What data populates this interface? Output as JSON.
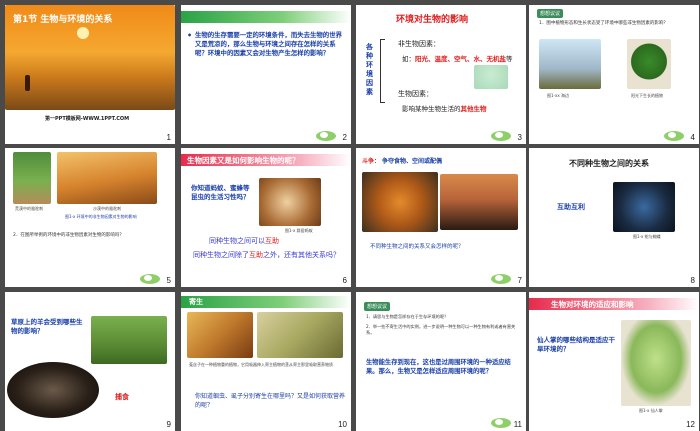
{
  "slides": [
    {
      "num": "1",
      "title": "第1节 生物与环境的关系",
      "footer": "第一PPT模板网-WWW.1PPT.COM"
    },
    {
      "num": "2",
      "bullet": "•",
      "text": "生物的生存需要一定的环境条件，而失去生物的世界又是荒凉的，那么生物与环境之间存在怎样的关系呢？环境中的因素又会对生物产生怎样的影响？"
    },
    {
      "num": "3",
      "title": "环境对生物的影响",
      "side": "各种环境因素",
      "abiotic": "非生物因素：",
      "abiotic_eg_prefix": "如：",
      "abiotic_eg": "阳光、温度、空气、水、无机盐",
      "abiotic_eg_suffix": "等",
      "biotic": "生物因素：",
      "biotic_desc_prefix": "影响某种生物生活的",
      "biotic_desc": "其他生物"
    },
    {
      "num": "4",
      "tag": "想想议议",
      "q": "1．图中植物形态和生长状态受了环境中哪些非生物因素的影响？",
      "cap1": "图1-xx 海边",
      "cap2": "阳光下生长的植物"
    },
    {
      "num": "5",
      "cap1": "荒漠中的骆驼刺",
      "cap2": "沙漠中的骆驼刺",
      "capline": "图1-x 环境中的非生物因素对生物的影响",
      "q": "2．在图所举例的环境中的非生物因素对生物的影响吗？"
    },
    {
      "num": "6",
      "title": "生物因素又是如何影响生物的呢？",
      "ask": "你知道蚂蚁、蜜蜂等昆虫的生活习性吗？",
      "cap": "图1-x 群居蚂蚁",
      "line1_prefix": "同种生物之间可以",
      "line1_key": "互助",
      "line2_prefix": "同种生物之间除了",
      "line2_key": "互助",
      "line2_suffix": "之外，还有其他关系吗？"
    },
    {
      "num": "7",
      "label": "斗争",
      "label_suffix": "：",
      "detail": "争夺食物、空间或配偶",
      "q": "不同种生物之间的关系又会怎样的呢？"
    },
    {
      "num": "8",
      "title": "不同种生物之间的关系",
      "key": "互助互利",
      "cap": "图1-x 蛇与蝴蝶"
    },
    {
      "num": "9",
      "q": "草原上的羊会受到哪些生物的影响？",
      "label": "捕食"
    },
    {
      "num": "10",
      "title": "寄生",
      "cap": "菟丝子在一种植物重的植物，它用吸器伸入寄主植物的茎从寄主那里吸取营养物质",
      "q": "你知道蛔虫、虱子分别寄生在哪里吗？又是如何获取营养的呢？"
    },
    {
      "num": "11",
      "tag": "想想议议",
      "q1": "1．请思与生物是怎样存在于生存环境的呢？",
      "q2": "2．举一些不寄生活中的实例，进一步说明一种生物可以一种生物有利或者有害关系。",
      "main": "生物能生存到现在，这也是过周围环境的一种适应结果。那么，生物又是怎样适应周围环境的呢？"
    },
    {
      "num": "12",
      "title": "生物对环境的适应和影响",
      "q": "仙人掌的哪些结构是适应干旱环境的？",
      "cap": "图1-x 仙人掌"
    }
  ],
  "colors": {
    "green": "#2aa246",
    "red": "#e72b4c",
    "blue": "#1a3fa8",
    "dark": "#4a4a4a"
  }
}
